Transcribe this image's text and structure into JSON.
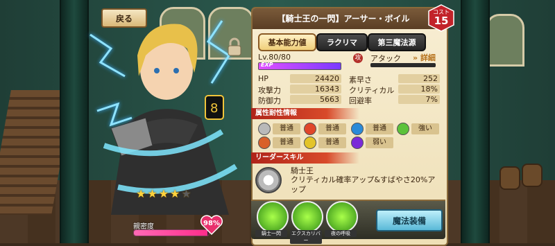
{
  "nav": {
    "back_label": "戻る"
  },
  "character": {
    "title": "【騎士王の一閃】アーサー・ボイル",
    "cost_label": "コスト",
    "cost": "15",
    "rarity_stars": 4,
    "max_stars": 5,
    "intimacy_label": "親密度",
    "intimacy_value": "98%",
    "intimacy_fraction": 0.98
  },
  "tabs": [
    {
      "label": "基本能力値",
      "active": true
    },
    {
      "label": "ラクリマ",
      "active": false
    },
    {
      "label": "第三魔法源",
      "active": false
    }
  ],
  "level": {
    "text": "Lv.80/80",
    "exp_label": "EXP",
    "exp_fraction": 1.0
  },
  "type": {
    "icon_char": "攻",
    "label": "アタック",
    "detail_label": "詳細"
  },
  "stats": {
    "hp_label": "HP",
    "hp": "24420",
    "atk_label": "攻撃力",
    "atk": "16343",
    "def_label": "防御力",
    "def": "5663",
    "spd_label": "素早さ",
    "spd": "252",
    "crit_label": "クリティカル",
    "crit": "18%",
    "eva_label": "回避率",
    "eva": "7%"
  },
  "resistances": {
    "header": "属性耐性情報",
    "items": [
      {
        "icon": "light-element-icon",
        "value": "普通",
        "color": "#b9b9b9"
      },
      {
        "icon": "fire-element-icon",
        "value": "普通",
        "color": "#e0462a"
      },
      {
        "icon": "ice-element-icon",
        "value": "普通",
        "color": "#2a8ad8"
      },
      {
        "icon": "wind-element-icon",
        "value": "強い",
        "color": "#5cc23a"
      },
      {
        "icon": "earth-element-icon",
        "value": "普通",
        "color": "#d8602a"
      },
      {
        "icon": "thunder-element-icon",
        "value": "普通",
        "color": "#e3c42a"
      },
      {
        "icon": "dark-element-icon",
        "value": "弱い",
        "color": "#7a2ad8"
      }
    ]
  },
  "leader_skill": {
    "header": "リーダースキル",
    "name": "騎士王",
    "description": "クリティカル確率アップ&すばやさ20%アップ"
  },
  "skills": [
    {
      "name": "騎士一閃"
    },
    {
      "name": "エクスカリバー"
    },
    {
      "name": "夜の呼吸"
    }
  ],
  "magic_button": "魔法装備",
  "colors": {
    "panel": "#f3e6c3",
    "accent_red": "#b0241a",
    "cost_badge": "#c2232a"
  }
}
